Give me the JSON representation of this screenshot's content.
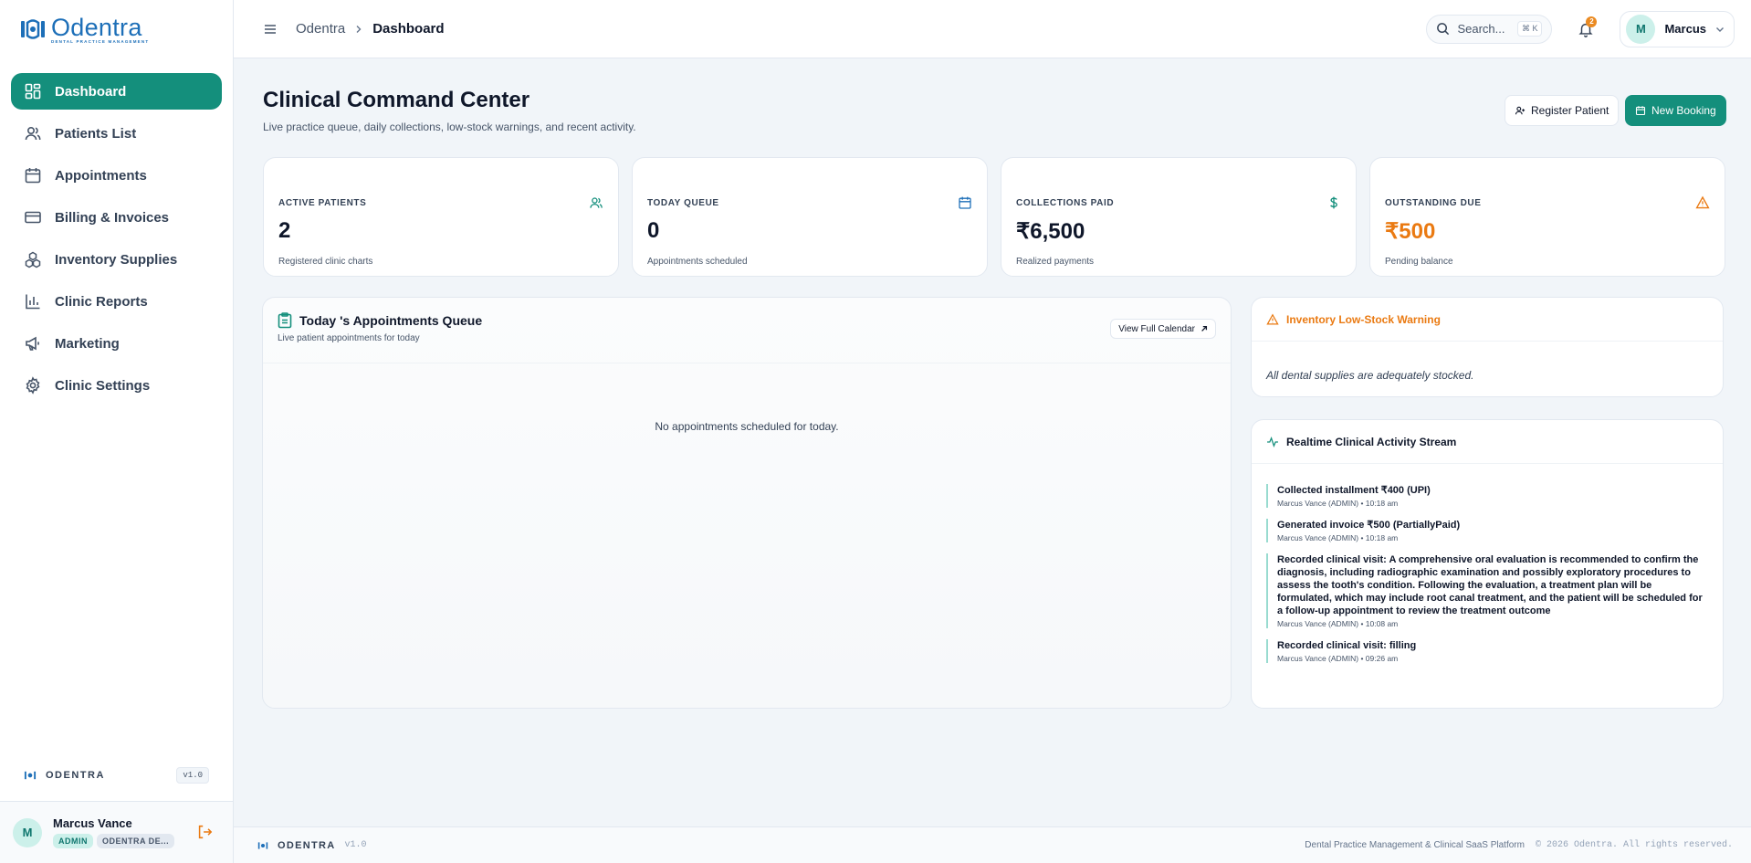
{
  "brand": {
    "name": "Odentra",
    "tagline": "DENTAL PRACTICE MANAGEMENT",
    "footer_name": "ODENTRA",
    "version": "v1.0",
    "accent": "#148f7c",
    "logo_blue": "#1d6fb8"
  },
  "sidebar": {
    "items": [
      {
        "label": "Dashboard",
        "icon": "dashboard-icon"
      },
      {
        "label": "Patients List",
        "icon": "users-icon"
      },
      {
        "label": "Appointments",
        "icon": "calendar-icon"
      },
      {
        "label": "Billing & Invoices",
        "icon": "credit-card-icon"
      },
      {
        "label": "Inventory Supplies",
        "icon": "boxes-icon"
      },
      {
        "label": "Clinic Reports",
        "icon": "bar-chart-icon"
      },
      {
        "label": "Marketing",
        "icon": "megaphone-icon"
      },
      {
        "label": "Clinic Settings",
        "icon": "gear-icon"
      }
    ],
    "user": {
      "initial": "M",
      "name": "Marcus Vance",
      "role": "ADMIN",
      "org": "ODENTRA DE..."
    }
  },
  "header": {
    "breadcrumb": [
      "Odentra",
      "Dashboard"
    ],
    "search_placeholder": "Search...",
    "search_shortcut": "⌘ K",
    "notification_count": "2",
    "user_initial": "M",
    "user_name": "Marcus"
  },
  "page": {
    "title": "Clinical Command Center",
    "subtitle": "Live practice queue, daily collections, low-stock warnings, and recent activity.",
    "register_label": "Register Patient",
    "booking_label": "New Booking"
  },
  "stats": [
    {
      "label": "ACTIVE PATIENTS",
      "value": "2",
      "desc": "Registered clinic charts",
      "icon": "users-icon"
    },
    {
      "label": "TODAY QUEUE",
      "value": "0",
      "desc": "Appointments scheduled",
      "icon": "calendar-icon"
    },
    {
      "label": "COLLECTIONS PAID",
      "value": "₹6,500",
      "desc": "Realized payments",
      "icon": "dollar-icon"
    },
    {
      "label": "OUTSTANDING DUE",
      "value": "₹500",
      "desc": "Pending balance",
      "icon": "warning-icon"
    }
  ],
  "queue": {
    "title": "Today 's Appointments Queue",
    "subtitle": "Live patient appointments for today",
    "calendar_label": "View Full Calendar",
    "empty": "No appointments scheduled for today."
  },
  "low_stock": {
    "title": "Inventory Low-Stock Warning",
    "message": "All dental supplies are adequately stocked."
  },
  "activity": {
    "title": "Realtime Clinical Activity Stream",
    "items": [
      {
        "text": "Collected installment ₹400 (UPI)",
        "meta": "Marcus Vance (ADMIN) • 10:18 am"
      },
      {
        "text": "Generated invoice ₹500 (PartiallyPaid)",
        "meta": "Marcus Vance (ADMIN) • 10:18 am"
      },
      {
        "text": "Recorded clinical visit: A comprehensive oral evaluation is recommended to confirm the diagnosis, including radiographic examination and possibly exploratory procedures to assess the tooth's condition. Following the evaluation, a treatment plan will be formulated, which may include root canal treatment, and the patient will be scheduled for a follow-up appointment to review the treatment outcome",
        "meta": "Marcus Vance (ADMIN) • 10:08 am"
      },
      {
        "text": "Recorded clinical visit: filling",
        "meta": "Marcus Vance (ADMIN) • 09:26 am"
      }
    ]
  },
  "footer": {
    "name": "ODENTRA",
    "version": "v1.0",
    "platform": "Dental Practice Management & Clinical SaaS Platform",
    "copyright": "© 2026 Odentra. All rights reserved."
  }
}
